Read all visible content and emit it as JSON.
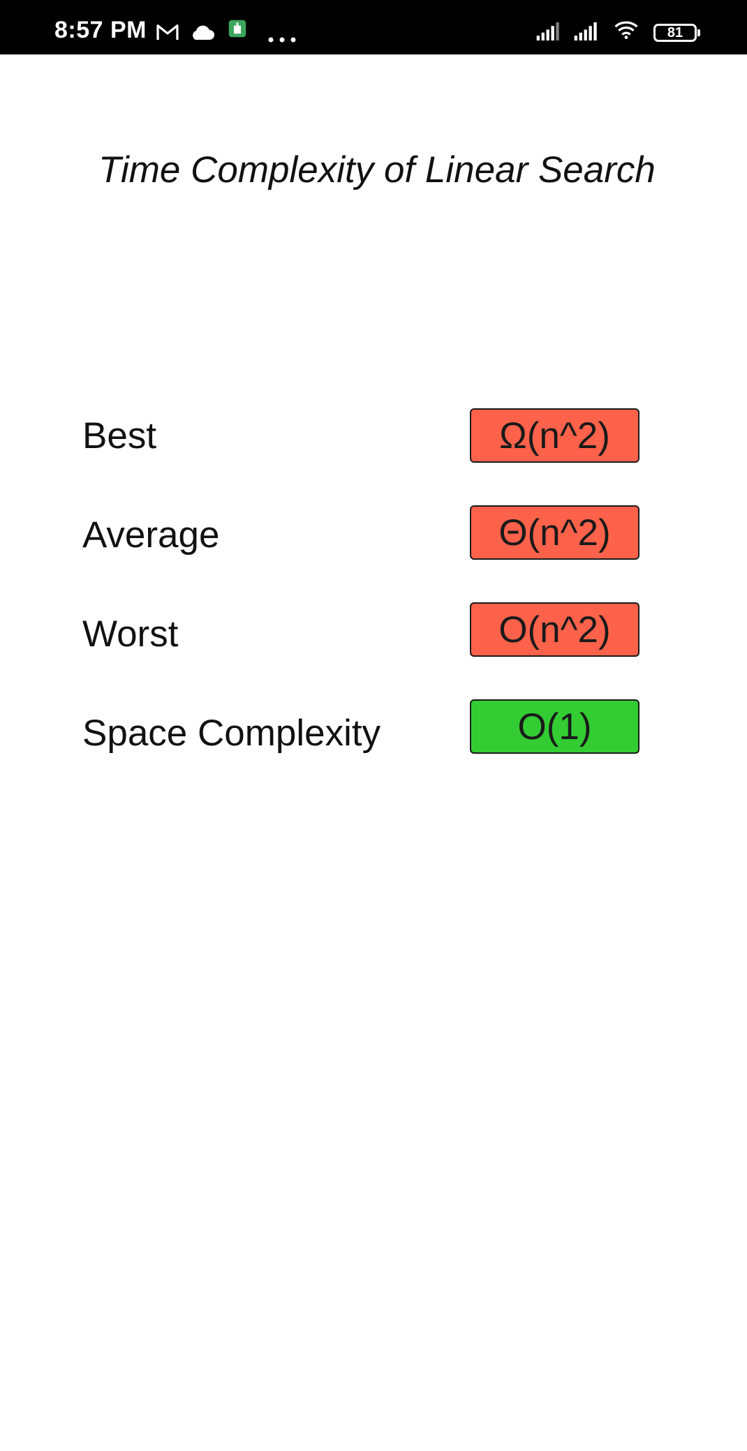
{
  "status_bar": {
    "time": "8:57 PM",
    "battery": "81",
    "icons": [
      "gmail-icon",
      "cloud-icon",
      "app-icon",
      "more-icon",
      "signal-icon",
      "signal-icon-2",
      "wifi-icon",
      "battery-icon"
    ]
  },
  "title": "Time Complexity of Linear Search",
  "rows": [
    {
      "label": "Best",
      "value": "Ω(n^2)",
      "color": "#ff624a"
    },
    {
      "label": "Average",
      "value": "Θ(n^2)",
      "color": "#ff624a"
    },
    {
      "label": "Worst",
      "value": "O(n^2)",
      "color": "#ff624a"
    },
    {
      "label": "Space Complexity",
      "value": "O(1)",
      "color": "#33cc33"
    }
  ]
}
